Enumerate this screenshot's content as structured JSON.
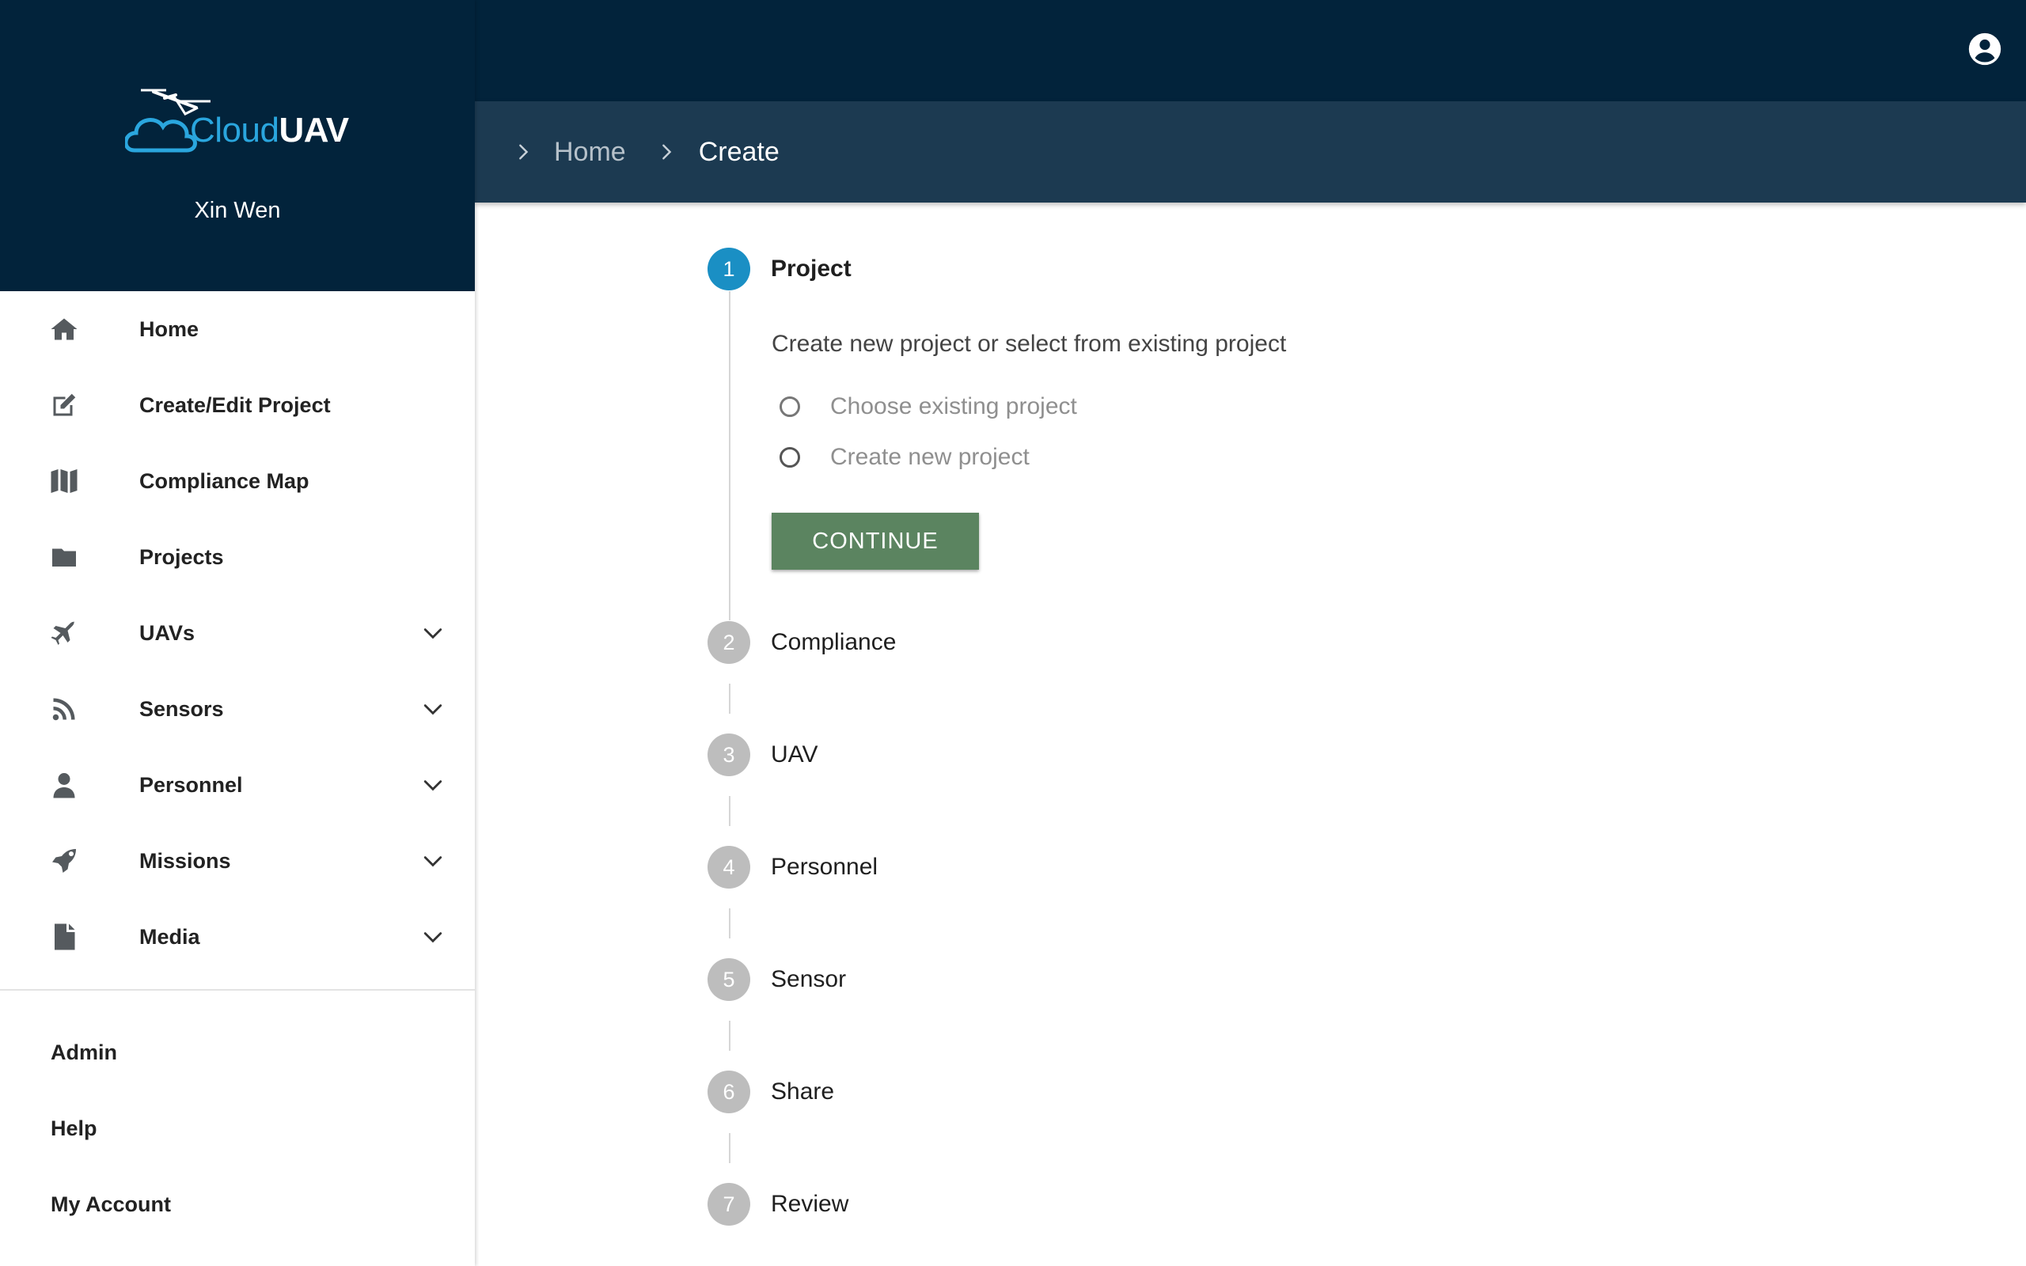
{
  "app": {
    "logo_text_part1": "Cloud",
    "logo_text_part2": "UAV",
    "user_name": "Xin Wen"
  },
  "header": {
    "account_icon": "account-circle-icon"
  },
  "breadcrumb": {
    "home": "Home",
    "current": "Create"
  },
  "sidebar": {
    "items": [
      {
        "label": "Home",
        "icon": "home-icon",
        "expandable": false
      },
      {
        "label": "Create/Edit Project",
        "icon": "edit-icon",
        "expandable": false
      },
      {
        "label": "Compliance Map",
        "icon": "map-icon",
        "expandable": false
      },
      {
        "label": "Projects",
        "icon": "folder-icon",
        "expandable": false
      },
      {
        "label": "UAVs",
        "icon": "plane-icon",
        "expandable": true
      },
      {
        "label": "Sensors",
        "icon": "rss-icon",
        "expandable": true
      },
      {
        "label": "Personnel",
        "icon": "user-icon",
        "expandable": true
      },
      {
        "label": "Missions",
        "icon": "rocket-icon",
        "expandable": true
      },
      {
        "label": "Media",
        "icon": "file-icon",
        "expandable": true
      }
    ],
    "sub_items": [
      {
        "label": "Admin"
      },
      {
        "label": "Help"
      },
      {
        "label": "My Account"
      }
    ]
  },
  "stepper": {
    "steps": [
      {
        "number": "1",
        "label": "Project",
        "active": true
      },
      {
        "number": "2",
        "label": "Compliance",
        "active": false
      },
      {
        "number": "3",
        "label": "UAV",
        "active": false
      },
      {
        "number": "4",
        "label": "Personnel",
        "active": false
      },
      {
        "number": "5",
        "label": "Sensor",
        "active": false
      },
      {
        "number": "6",
        "label": "Share",
        "active": false
      },
      {
        "number": "7",
        "label": "Review",
        "active": false
      }
    ],
    "project_step": {
      "description": "Create new project or select from existing project",
      "options": [
        {
          "label": "Choose existing project",
          "selected": false
        },
        {
          "label": "Create new project",
          "selected": false
        }
      ],
      "continue_label": "CONTINUE"
    }
  },
  "colors": {
    "sidebar_header": "#02233b",
    "breadcrumb_bar": "#1c3a51",
    "active_step": "#1a8fc4",
    "inactive_step": "#bdbdbd",
    "continue_button": "#5b8460",
    "logo_accent": "#2aa6de"
  }
}
